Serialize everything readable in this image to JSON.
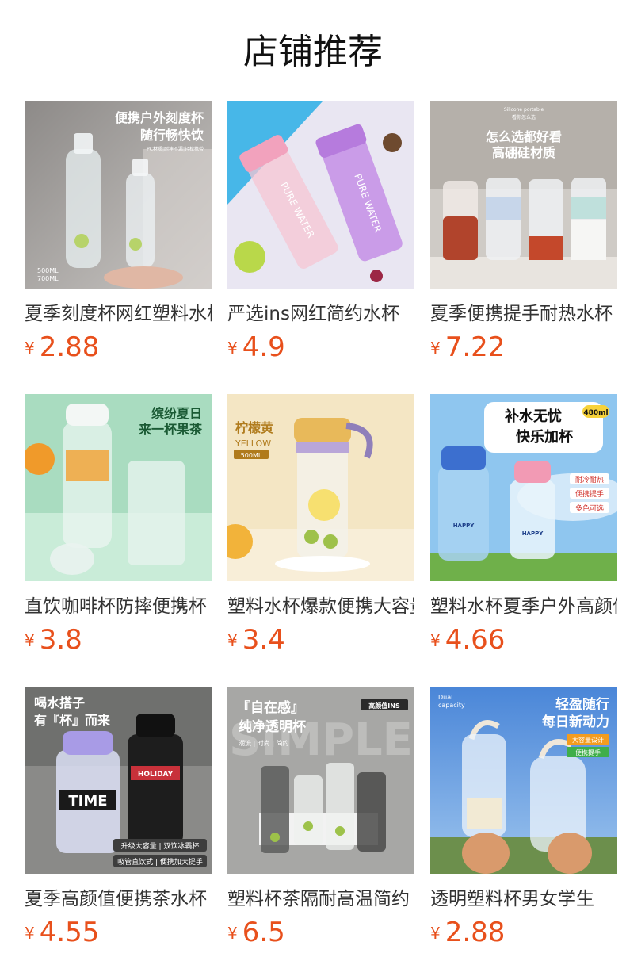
{
  "header": {
    "title": "店铺推荐"
  },
  "currency": "¥",
  "colors": {
    "price": "#e8501c",
    "name": "#333333",
    "title": "#111111"
  },
  "products": [
    {
      "name": "夏季刻度杯网红塑料水杯",
      "price": "2.88",
      "image_text": [
        "便携户外刻度杯",
        "随行畅快饮",
        "PC材质|耐摔不漏|轻松携带",
        "500ML",
        "700ML"
      ]
    },
    {
      "name": "严选ins网红简约水杯",
      "price": "4.9",
      "image_text": [
        "PURE WATER",
        "PURE WATER"
      ]
    },
    {
      "name": "夏季便携提手耐热水杯",
      "price": "7.22",
      "image_text": [
        "Silicone portable",
        "看你怎么选",
        "怎么选都好看",
        "高硼硅材质"
      ]
    },
    {
      "name": "直饮咖啡杯防摔便携杯",
      "price": "3.8",
      "image_text": [
        "缤纷夏日",
        "来一杯果茶"
      ]
    },
    {
      "name": "塑料水杯爆款便携大容量",
      "price": "3.4",
      "image_text": [
        "柠檬黄",
        "YELLOW",
        "500ML"
      ]
    },
    {
      "name": "塑料水杯夏季户外高颜值",
      "price": "4.66",
      "image_text": [
        "补水无忧",
        "快乐加杯",
        "480ml",
        "耐冷耐热",
        "便携提手",
        "多色可选",
        "HAPPY",
        "HAPPY"
      ]
    },
    {
      "name": "夏季高颜值便携茶水杯",
      "price": "4.55",
      "image_text": [
        "喝水搭子",
        "有『杯』而来",
        "TIME",
        "HOLIDAY",
        "升级大容量 | 双饮冰霸杯",
        "吸管直饮式 | 便携加大提手"
      ]
    },
    {
      "name": "塑料杯茶隔耐高温简约",
      "price": "6.5",
      "image_text": [
        "『自在感』",
        "纯净透明杯",
        "高颜值INS",
        "潮流 | 时尚 | 简约",
        "SIMPLE"
      ]
    },
    {
      "name": "透明塑料杯男女学生",
      "price": "2.88",
      "image_text": [
        "Dual",
        "capacity",
        "轻盈随行",
        "每日新动力",
        "大容量设计",
        "便携提手"
      ]
    }
  ]
}
